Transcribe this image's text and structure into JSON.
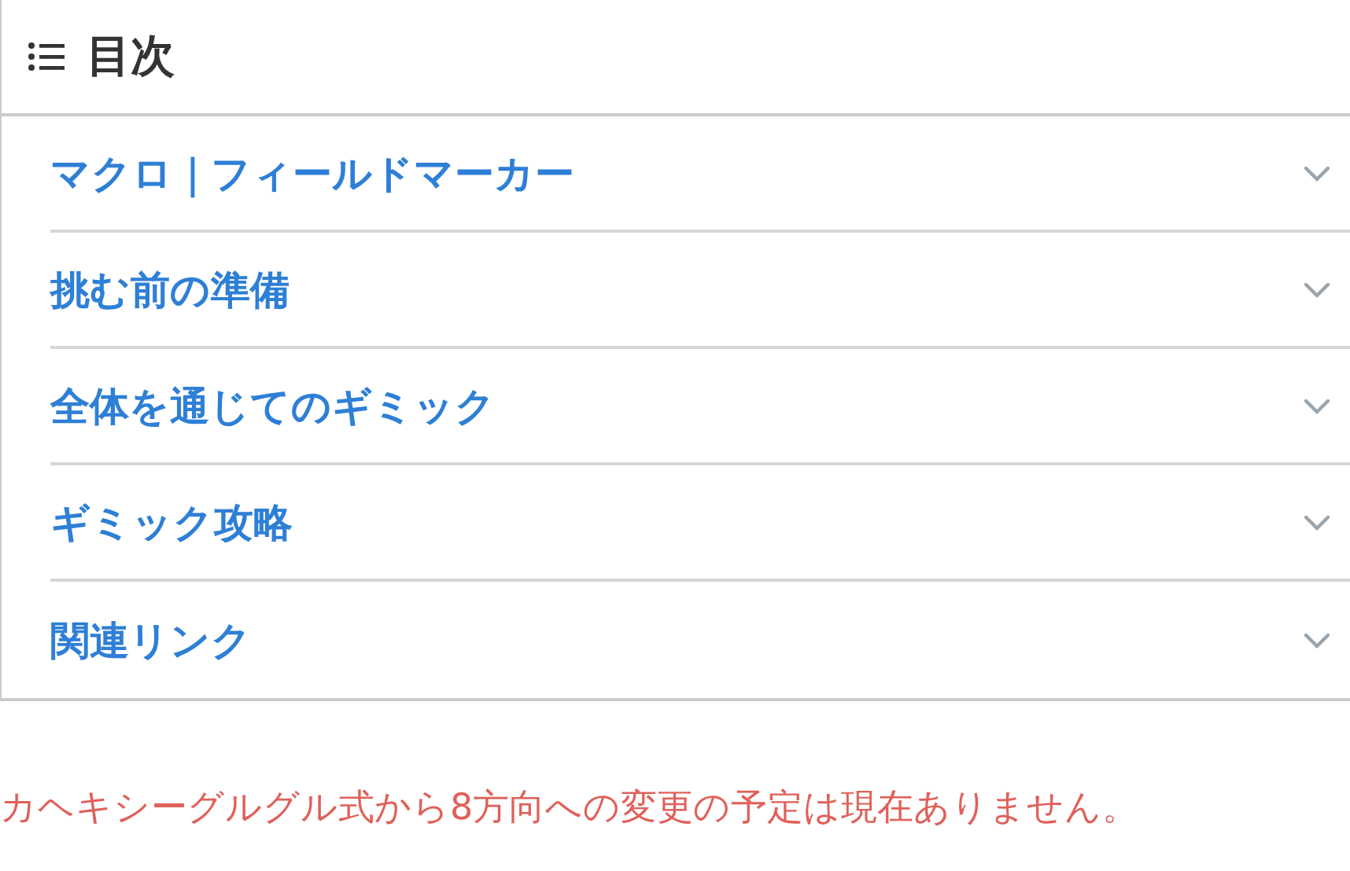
{
  "toc": {
    "title": "目次",
    "items": [
      {
        "label": "マクロ｜フィールドマーカー",
        "expanded": false
      },
      {
        "label": "挑む前の準備",
        "expanded": false
      },
      {
        "label": "全体を通じてのギミック",
        "expanded": false
      },
      {
        "label": "ギミック攻略",
        "expanded": false
      },
      {
        "label": "関連リンク",
        "expanded": false
      }
    ]
  },
  "note": "カヘキシーグルグル式から8方向への変更の予定は現在ありません。"
}
